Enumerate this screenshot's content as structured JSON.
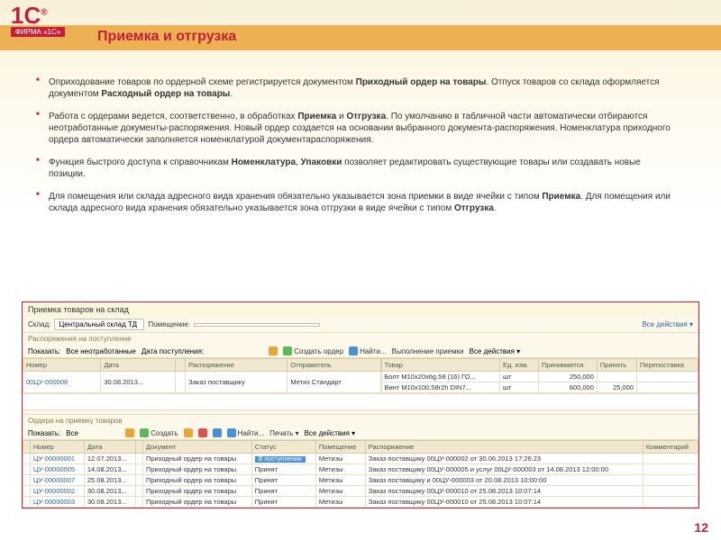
{
  "logo": {
    "top": "1С",
    "reg": "®",
    "bottom": "ФИРМА «1С»"
  },
  "title": "Приемка и отгрузка",
  "bullets": [
    {
      "pre": "Оприходование товаров по ордерной схеме регистрируется документом ",
      "b1": "Приходный ордер на товары",
      "mid": ". Отпуск товаров со склада оформляется документом ",
      "b2": "Расходный ордер на товары",
      "post": "."
    },
    {
      "pre": "Работа с ордерами ведется, соответственно, в обработках ",
      "b1": "Приемка",
      "mid": " и ",
      "b2": "Отгрузка",
      "post": ". По умолчанию в табличной части автоматически отбираются неотработанные документы-распоряжения. Новый ордер создается на основании выбранного документа-распоряжения. Номенклатура приходного ордера автоматически заполняется номенклатурой документараспоряжения."
    },
    {
      "pre": "Функция быстрого доступа к справочникам ",
      "b1": "Номенклатура",
      "mid": ", ",
      "b2": "Упаковки",
      "post": " позволяет редактировать существующие товары или создавать новые позиции."
    },
    {
      "pre": "Для помещения или склада адресного вида хранения обязательно указывается зона приемки в виде ячейки с типом ",
      "b1": "Приемка",
      "mid": ". Для помещения или склада адресного вида хранения обязательно указывается зона отгрузки в виде ячейки с типом ",
      "b2": "Отгрузка",
      "post": "."
    }
  ],
  "app": {
    "title": "Приемка товаров на склад",
    "warehouse_lbl": "Склад:",
    "warehouse": "Центральный склад ТД",
    "room_lbl": "Помещение:",
    "all_actions": "Все действия ▾",
    "sec1": "Распоряжения на поступление",
    "tb1": {
      "show_lbl": "Показать:",
      "show": "Все неотработанные",
      "date_lbl": "Дата поступления:",
      "create": "Создать ордер",
      "find": "Найти...",
      "exec": "Выполнение приемки"
    },
    "cols1": [
      "Номер",
      "Дата",
      "",
      "Распоряжение",
      "Отправитель"
    ],
    "rows1": [
      [
        "00ЦУ-000008",
        "30.08.2013...",
        "",
        "Заказ поставщику",
        "Метиз Стандарт"
      ]
    ],
    "cols1r": [
      "Товар",
      "Ед. изм.",
      "Принимается",
      "Принять",
      "Перепоставка"
    ],
    "rows1r": [
      [
        "Болт M10x20x6g.58 (16) ГО...",
        "шт",
        "250,000",
        "",
        ""
      ],
      [
        "Винт M10x100.58r2h DIN7...",
        "шт",
        "600,000",
        "25,000",
        ""
      ]
    ],
    "sec2": "Ордера на приемку товаров",
    "tb2": {
      "show_lbl": "Показать:",
      "show": "Все",
      "create": "Создать",
      "find": "Найти...",
      "print": "Печать ▾"
    },
    "cols2": [
      "",
      "Номер",
      "Дата",
      "",
      "Документ",
      "Статус",
      "Помещение",
      "Распоряжение",
      "Комментарий"
    ],
    "rows2": [
      [
        "",
        "ЦУ-00000001",
        "12.07.2013...",
        "",
        "Приходный ордер на товары",
        "В поступлении",
        "Метизы",
        "Заказ поставщику 00ЦУ-000002 от 30.06.2013 17:26:23",
        ""
      ],
      [
        "",
        "ЦУ-00000005",
        "14.08.2013...",
        "",
        "Приходный ордер на товары",
        "Принят",
        "Метизы",
        "Заказ поставщику 00ЦУ-000005 и услуг 00ЦУ-000003 от 14.08.2013 12:00:00",
        ""
      ],
      [
        "",
        "ЦУ-00000007",
        "25.08.2013...",
        "",
        "Приходный ордер на товары",
        "Принят",
        "Метизы",
        "Заказ поставщику и 00ЦУ-000003 от 20.08.2013 10:00:00",
        ""
      ],
      [
        "",
        "ЦУ-00000002",
        "30.08.2013...",
        "",
        "Приходный ордер на товары",
        "Принят",
        "Метизы",
        "Заказ поставщику 00ЦУ-000010 от 25.08.2013 10:07:14",
        ""
      ],
      [
        "",
        "ЦУ-00000003",
        "30.08.2013...",
        "",
        "Приходный ордер на товары",
        "Принят",
        "Метизы",
        "Заказ поставщику 00ЦУ-000010 от 25.08.2013 10:07:14",
        ""
      ]
    ]
  },
  "page": "12"
}
